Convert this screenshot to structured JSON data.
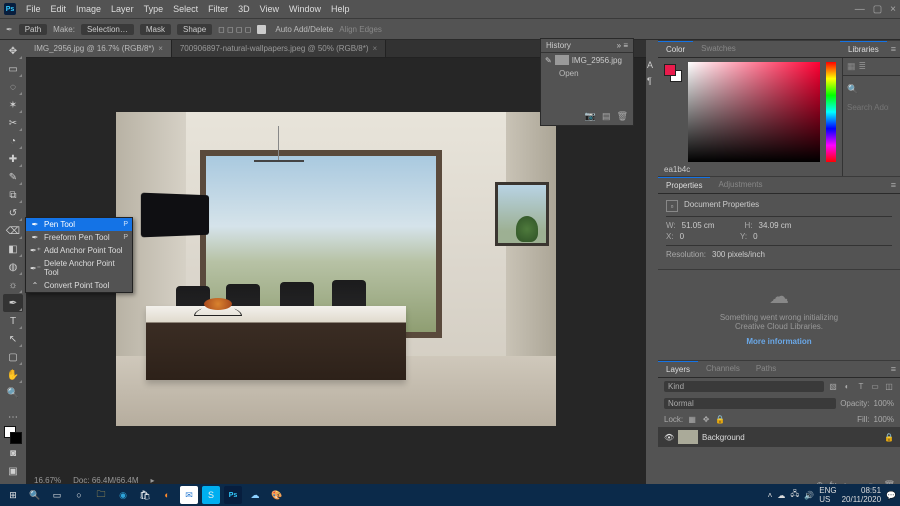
{
  "app": {
    "name": "Ps"
  },
  "menu": [
    "File",
    "Edit",
    "Image",
    "Layer",
    "Type",
    "Select",
    "Filter",
    "3D",
    "View",
    "Window",
    "Help"
  ],
  "winctrl": {
    "min": "—",
    "max": "▢",
    "close": "×"
  },
  "options": {
    "toolIcon": "✒",
    "pathLabel": "Path",
    "makeLabel": "Make:",
    "makeVal": "Selection…",
    "mask": "Mask",
    "shape": "Shape",
    "ops": "◻ ◻ ◻ ◻",
    "autoAdd": "Auto Add/Delete",
    "alignEdges": "Align Edges"
  },
  "doctabs": [
    {
      "label": "IMG_2956.jpg @ 16.7% (RGB/8*)",
      "active": true
    },
    {
      "label": "700906897-natural-wallpapers.jpeg @ 50% (RGB/8*)",
      "active": false
    }
  ],
  "flyout": [
    {
      "icon": "✒",
      "label": "Pen Tool",
      "sc": "P",
      "sel": true
    },
    {
      "icon": "✒",
      "label": "Freeform Pen Tool",
      "sc": "P"
    },
    {
      "icon": "✒⁺",
      "label": "Add Anchor Point Tool",
      "sc": ""
    },
    {
      "icon": "✒⁻",
      "label": "Delete Anchor Point Tool",
      "sc": ""
    },
    {
      "icon": "⌃",
      "label": "Convert Point Tool",
      "sc": ""
    }
  ],
  "status": {
    "zoom": "16.67%",
    "info": "Doc: 66.4M/66.4M"
  },
  "history": {
    "title": "History",
    "thumbLabel": "IMG_2956.jpg",
    "steps": [
      "Open"
    ],
    "footIcons": [
      "📷",
      "🗑",
      "▤"
    ]
  },
  "colorTabs": [
    "Color",
    "Swatches"
  ],
  "libTab": "Libraries",
  "libSearchPh": "Search Adobe Stock",
  "libViewIcons": [
    "▦",
    "≣"
  ],
  "colorHex": "ea1b4c",
  "propTabs": [
    "Properties",
    "Adjustments"
  ],
  "props": {
    "title": "Document Properties",
    "wLabel": "W:",
    "wVal": "51.05 cm",
    "hLabel": "H:",
    "hVal": "34.09 cm",
    "xLabel": "X:",
    "xVal": "0",
    "yLabel": "Y:",
    "yVal": "0",
    "resLabel": "Resolution:",
    "resVal": "300 pixels/inch"
  },
  "libs": {
    "line1": "Something went wrong initializing",
    "line2": "Creative Cloud Libraries.",
    "more": "More information"
  },
  "layersTabs": [
    "Layers",
    "Channels",
    "Paths"
  ],
  "layers": {
    "kind": "Kind",
    "mode": "Normal",
    "opacityL": "Opacity:",
    "opacity": "100%",
    "lockL": "Lock:",
    "fillL": "Fill:",
    "fill": "100%",
    "bg": "Background",
    "footIcons": [
      "⊕",
      "fx",
      "◐",
      "▭",
      "🗀",
      "🗑"
    ]
  },
  "taskbar": {
    "lang": "ENG",
    "loc": "US",
    "time": "08:51",
    "date": "20/11/2020"
  }
}
